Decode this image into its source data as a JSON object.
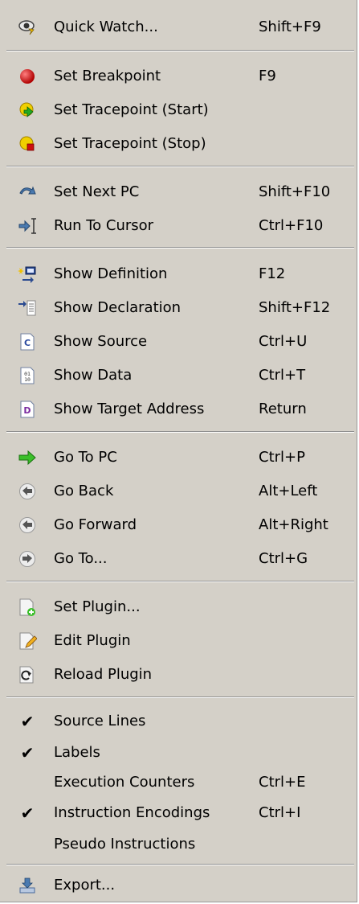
{
  "menu": {
    "items": [
      {
        "label": "Quick Watch...",
        "shortcut": "Shift+F9",
        "icon": "quick-watch-icon"
      },
      {
        "label": "Set Breakpoint",
        "shortcut": "F9",
        "icon": "breakpoint-icon"
      },
      {
        "label": "Set Tracepoint (Start)",
        "shortcut": "",
        "icon": "tracepoint-start-icon"
      },
      {
        "label": "Set Tracepoint (Stop)",
        "shortcut": "",
        "icon": "tracepoint-stop-icon"
      },
      {
        "label": "Set Next PC",
        "shortcut": "Shift+F10",
        "icon": "next-pc-icon"
      },
      {
        "label": "Run To Cursor",
        "shortcut": "Ctrl+F10",
        "icon": "run-to-cursor-icon"
      },
      {
        "label": "Show Definition",
        "shortcut": "F12",
        "icon": "definition-icon"
      },
      {
        "label": "Show Declaration",
        "shortcut": "Shift+F12",
        "icon": "declaration-icon"
      },
      {
        "label": "Show Source",
        "shortcut": "Ctrl+U",
        "icon": "source-file-icon"
      },
      {
        "label": "Show Data",
        "shortcut": "Ctrl+T",
        "icon": "data-file-icon"
      },
      {
        "label": "Show Target Address",
        "shortcut": "Return",
        "icon": "disassembly-file-icon"
      },
      {
        "label": "Go To PC",
        "shortcut": "Ctrl+P",
        "icon": "green-arrow-icon"
      },
      {
        "label": "Go Back",
        "shortcut": "Alt+Left",
        "icon": "back-icon"
      },
      {
        "label": "Go Forward",
        "shortcut": "Alt+Right",
        "icon": "forward-icon"
      },
      {
        "label": "Go To...",
        "shortcut": "Ctrl+G",
        "icon": "goto-icon"
      },
      {
        "label": "Set Plugin...",
        "shortcut": "",
        "icon": "add-plugin-icon"
      },
      {
        "label": "Edit Plugin",
        "shortcut": "",
        "icon": "edit-plugin-icon"
      },
      {
        "label": "Reload Plugin",
        "shortcut": "",
        "icon": "reload-plugin-icon"
      },
      {
        "label": "Source Lines",
        "shortcut": "",
        "icon": "checkmark-icon",
        "checked": true
      },
      {
        "label": "Labels",
        "shortcut": "",
        "icon": "checkmark-icon",
        "checked": true
      },
      {
        "label": "Execution Counters",
        "shortcut": "Ctrl+E",
        "icon": "",
        "checked": false
      },
      {
        "label": "Instruction Encodings",
        "shortcut": "Ctrl+I",
        "icon": "checkmark-icon",
        "checked": true
      },
      {
        "label": "Pseudo Instructions",
        "shortcut": "",
        "icon": "",
        "checked": false
      },
      {
        "label": "Export...",
        "shortcut": "",
        "icon": "export-icon"
      }
    ]
  },
  "colors": {
    "menu_background": "#d4d0c8",
    "breakpoint_red": "#d01010",
    "tracepoint_yellow": "#f0d000",
    "go_green": "#22aa22"
  }
}
